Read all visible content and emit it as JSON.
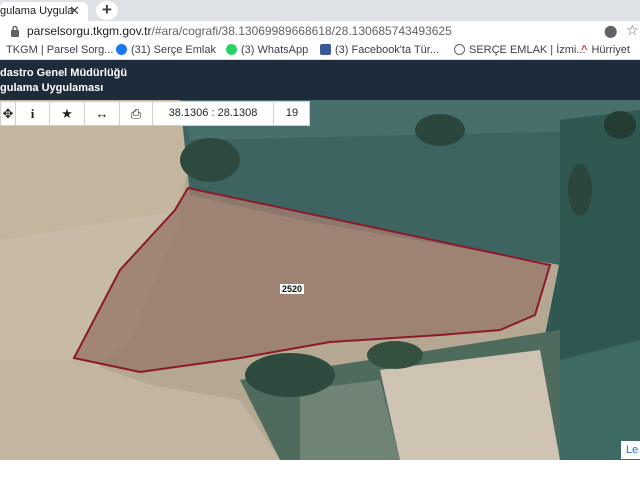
{
  "browser": {
    "tab_title": "gulama Uygula",
    "tab_close": "✕",
    "new_tab": "+",
    "url_host": "parselsorgu.tkgm.gov.tr",
    "url_path": "/#ara/cografi/38.13069989668618/28.130685743493625"
  },
  "bookmarks": [
    {
      "label": "TKGM | Parsel Sorg...",
      "icon": "tkgm-icon",
      "color": "#c0392b"
    },
    {
      "label": "(31) Serçe Emlak",
      "icon": "facebook-icon",
      "color": "#1877f2"
    },
    {
      "label": "(3) WhatsApp",
      "icon": "whatsapp-icon",
      "color": "#25d366"
    },
    {
      "label": "(3) Facebook'ta Tür...",
      "icon": "image-icon",
      "color": "#3b5998"
    },
    {
      "label": "SERÇE EMLAK | İzmi...",
      "icon": "globe-icon",
      "color": "#5f6368"
    },
    {
      "label": "Hürriyet",
      "icon": "hurriyet-icon",
      "color": "#d32f2f"
    }
  ],
  "app": {
    "title_line1": "dastro Genel Müdürlüğü",
    "title_line2": "gulama Uygulaması"
  },
  "toolbar": {
    "coords": "38.1306 : 28.1308",
    "zoom": "19",
    "tools": [
      "move-icon",
      "info-icon",
      "favorite-icon",
      "measure-icon",
      "print-icon"
    ]
  },
  "map": {
    "parcel_number": "2520",
    "parcel_outline_color": "#8b1a2b",
    "attribution": "Le"
  }
}
